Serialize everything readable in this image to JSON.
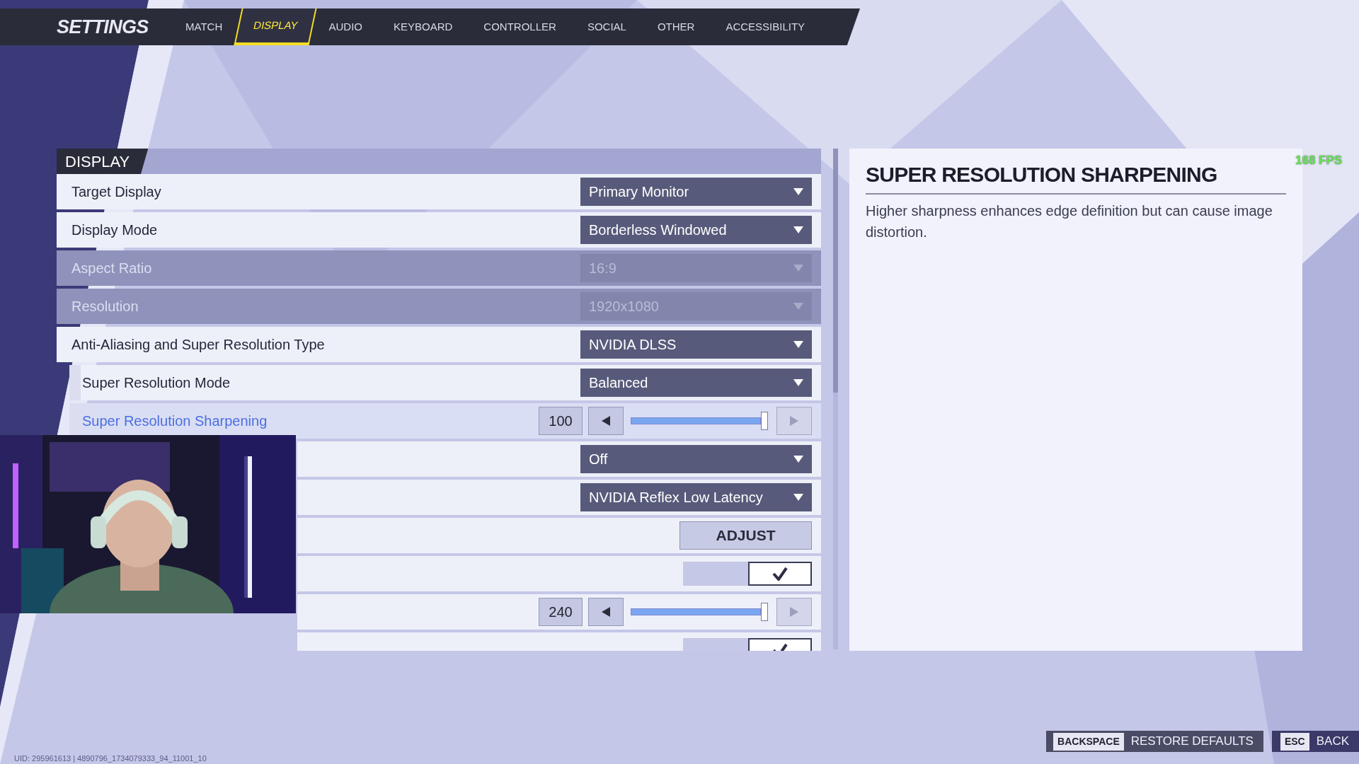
{
  "header": {
    "title": "SETTINGS"
  },
  "tabs": [
    {
      "label": "MATCH",
      "selected": false
    },
    {
      "label": "DISPLAY",
      "selected": true
    },
    {
      "label": "AUDIO",
      "selected": false
    },
    {
      "label": "KEYBOARD",
      "selected": false
    },
    {
      "label": "CONTROLLER",
      "selected": false
    },
    {
      "label": "SOCIAL",
      "selected": false
    },
    {
      "label": "OTHER",
      "selected": false
    },
    {
      "label": "ACCESSIBILITY",
      "selected": false
    }
  ],
  "section": {
    "title": "DISPLAY"
  },
  "rows": [
    {
      "kind": "dropdown",
      "label": "Target Display",
      "value": "Primary Monitor",
      "disabled": false,
      "sub": false,
      "selected": false
    },
    {
      "kind": "dropdown",
      "label": "Display Mode",
      "value": "Borderless Windowed",
      "disabled": false,
      "sub": false,
      "selected": false
    },
    {
      "kind": "dropdown",
      "label": "Aspect Ratio",
      "value": "16:9",
      "disabled": true,
      "sub": false,
      "selected": false
    },
    {
      "kind": "dropdown",
      "label": "Resolution",
      "value": "1920x1080",
      "disabled": true,
      "sub": false,
      "selected": false
    },
    {
      "kind": "dropdown",
      "label": "Anti-Aliasing and Super Resolution Type",
      "value": "NVIDIA DLSS",
      "disabled": false,
      "sub": false,
      "selected": false
    },
    {
      "kind": "dropdown",
      "label": "Super Resolution Mode",
      "value": "Balanced",
      "disabled": false,
      "sub": true,
      "selected": false
    },
    {
      "kind": "slider",
      "label": "Super Resolution Sharpening",
      "value": "100",
      "level": 0.97,
      "disabled": false,
      "sub": true,
      "selected": true
    },
    {
      "kind": "dropdown",
      "value": "Off",
      "disabled": false,
      "sub": false,
      "selected": false
    },
    {
      "kind": "dropdown",
      "value": "NVIDIA Reflex Low Latency",
      "disabled": false,
      "sub": false,
      "selected": false
    },
    {
      "kind": "button",
      "value": "ADJUST",
      "disabled": false,
      "sub": false,
      "selected": false
    },
    {
      "kind": "checkbox",
      "checked": true,
      "disabled": false,
      "sub": false,
      "selected": false
    },
    {
      "kind": "slider",
      "value": "240",
      "level": 0.97,
      "disabled": false,
      "sub": false,
      "selected": false
    },
    {
      "kind": "checkbox",
      "checked": true,
      "disabled": false,
      "sub": false,
      "selected": false
    }
  ],
  "description": {
    "title": "SUPER RESOLUTION SHARPENING",
    "text": "Higher sharpness enhances edge definition but can cause image distortion."
  },
  "fps_counter": "168 FPS",
  "footer": {
    "uid": "UID: 295961613 | 4890796_1734079333_94_11001_10",
    "actions": [
      {
        "key": "BACKSPACE",
        "label": "RESTORE DEFAULTS"
      },
      {
        "key": "ESC",
        "label": "BACK"
      }
    ]
  }
}
